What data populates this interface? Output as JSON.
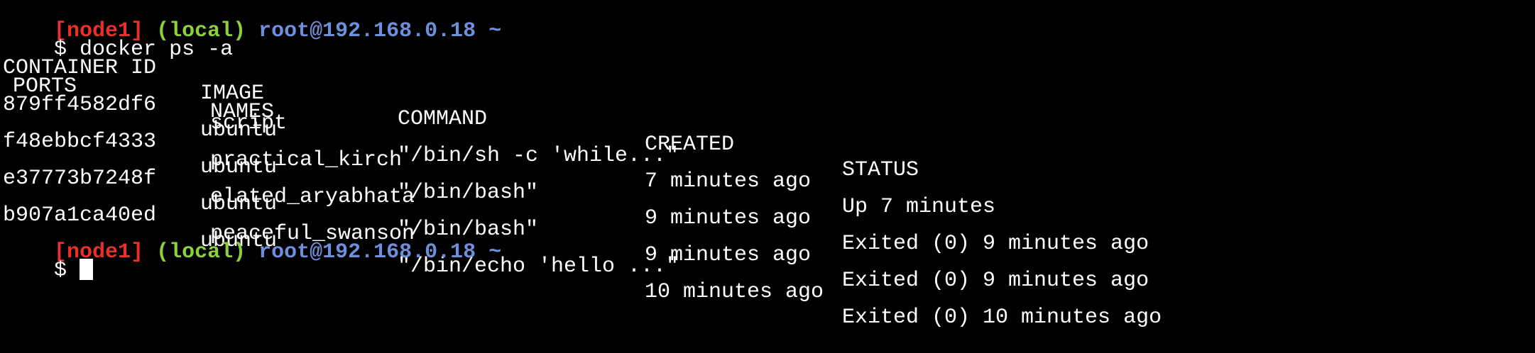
{
  "prompt": {
    "node": "[node1]",
    "env": "(local)",
    "host": "root@192.168.0.18",
    "path": "~",
    "symbol": "$"
  },
  "command": "docker ps -a",
  "headers": {
    "container_id": "CONTAINER ID",
    "image": "IMAGE",
    "command": "COMMAND",
    "created": "CREATED",
    "status": "STATUS",
    "ports": "PORTS",
    "names": "NAMES"
  },
  "containers": [
    {
      "id": "879ff4582df6",
      "image": "ubuntu",
      "command": "\"/bin/sh -c 'while...\"",
      "created": "7 minutes ago",
      "status": "Up 7 minutes",
      "name": "script"
    },
    {
      "id": "f48ebbcf4333",
      "image": "ubuntu",
      "command": "\"/bin/bash\"",
      "created": "9 minutes ago",
      "status": "Exited (0) 9 minutes ago",
      "name": "practical_kirch"
    },
    {
      "id": "e37773b7248f",
      "image": "ubuntu",
      "command": "\"/bin/bash\"",
      "created": "9 minutes ago",
      "status": "Exited (0) 9 minutes ago",
      "name": "elated_aryabhata"
    },
    {
      "id": "b907a1ca40ed",
      "image": "ubuntu",
      "command": "\"/bin/echo 'hello ...\"",
      "created": "10 minutes ago",
      "status": "Exited (0) 10 minutes ago",
      "name": "peaceful_swanson"
    }
  ],
  "colors": {
    "background": "#000000",
    "text": "#ffffff",
    "node": "#e8312b",
    "env": "#8bd13b",
    "host": "#6f8fd9"
  }
}
